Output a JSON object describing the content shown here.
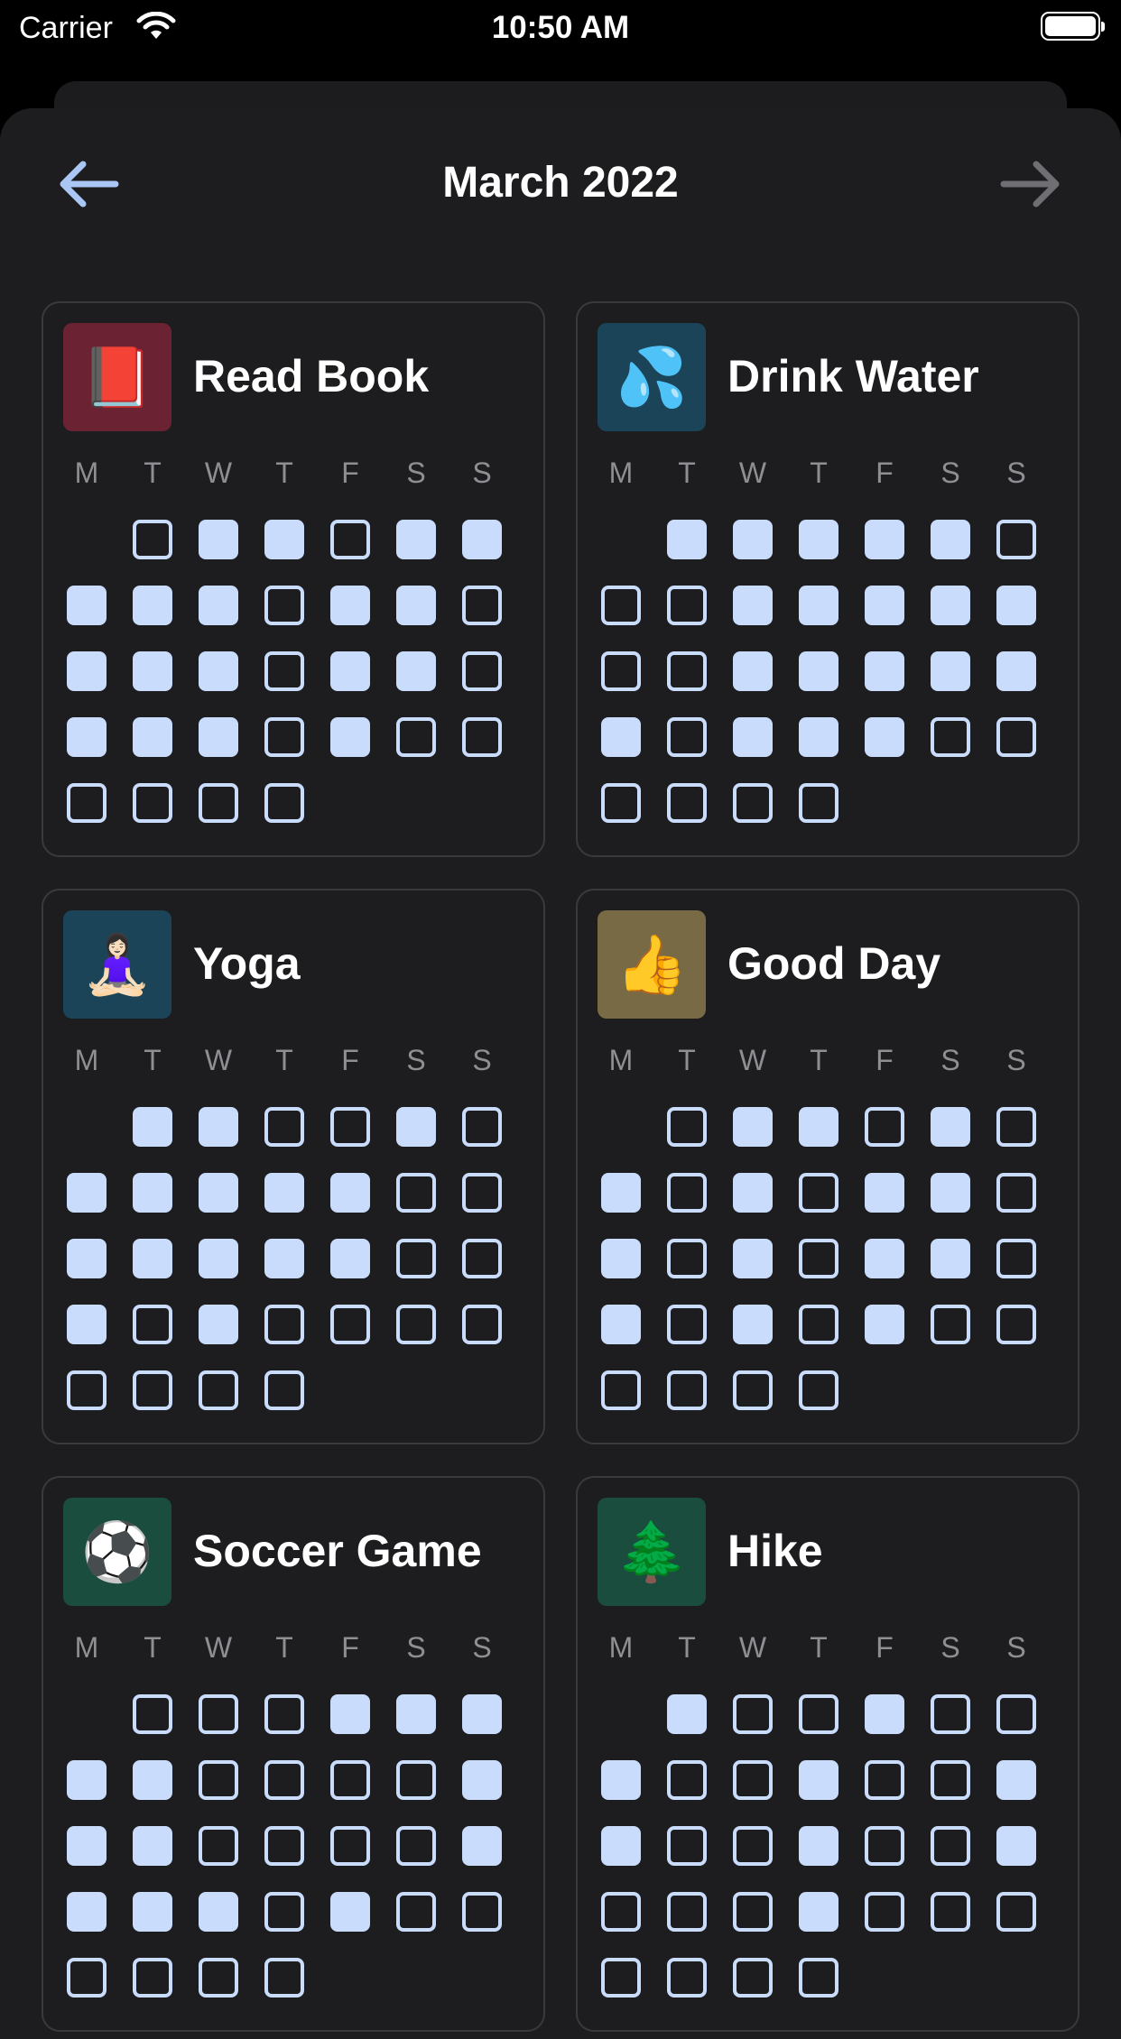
{
  "status_bar": {
    "carrier": "Carrier",
    "time": "10:50 AM"
  },
  "header": {
    "title": "March 2022",
    "back_icon": "arrow-left-icon",
    "next_icon": "arrow-right-icon"
  },
  "colors": {
    "accent": "#c9dcfb",
    "background": "#1d1d20",
    "card_border": "#3a3a3d",
    "weekday": "#8e8e93",
    "next_disabled": "#8e8e93",
    "back_arrow": "#a9c6f5"
  },
  "weekday_labels": [
    "M",
    "T",
    "W",
    "T",
    "F",
    "S",
    "S"
  ],
  "first_weekday_offset": 1,
  "habits": [
    {
      "title": "Read Book",
      "emoji": "📕",
      "icon_color": "#6b2334",
      "days": [
        0,
        1,
        1,
        0,
        1,
        1,
        1,
        1,
        1,
        0,
        1,
        1,
        0,
        1,
        1,
        1,
        0,
        1,
        1,
        0,
        1,
        1,
        1,
        0,
        1,
        0,
        0,
        0,
        0,
        0,
        0
      ]
    },
    {
      "title": "Drink Water",
      "emoji": "💦",
      "icon_color": "#1b4459",
      "days": [
        1,
        1,
        1,
        1,
        1,
        0,
        0,
        0,
        1,
        1,
        1,
        1,
        1,
        0,
        0,
        1,
        1,
        1,
        1,
        1,
        1,
        0,
        1,
        1,
        1,
        0,
        0,
        0,
        0,
        0,
        0
      ]
    },
    {
      "title": "Yoga",
      "emoji": "🧘🏻‍♀️",
      "icon_color": "#1b4459",
      "days": [
        1,
        1,
        0,
        0,
        1,
        0,
        1,
        1,
        1,
        1,
        1,
        0,
        0,
        1,
        1,
        1,
        1,
        1,
        0,
        0,
        1,
        0,
        1,
        0,
        0,
        0,
        0,
        0,
        0,
        0,
        0
      ]
    },
    {
      "title": "Good Day",
      "emoji": "👍",
      "icon_color": "#786a45",
      "days": [
        0,
        1,
        1,
        0,
        1,
        0,
        1,
        0,
        1,
        0,
        1,
        1,
        0,
        1,
        0,
        1,
        0,
        1,
        1,
        0,
        1,
        0,
        1,
        0,
        1,
        0,
        0,
        0,
        0,
        0,
        0
      ]
    },
    {
      "title": "Soccer Game",
      "emoji": "⚽",
      "icon_color": "#1b4d3e",
      "days": [
        0,
        0,
        0,
        1,
        1,
        1,
        1,
        1,
        0,
        0,
        0,
        0,
        1,
        1,
        1,
        0,
        0,
        0,
        0,
        1,
        1,
        1,
        1,
        0,
        1,
        0,
        0,
        0,
        0,
        0,
        0
      ]
    },
    {
      "title": "Hike",
      "emoji": "🌲",
      "icon_color": "#1b4d3e",
      "days": [
        1,
        0,
        0,
        1,
        0,
        0,
        1,
        0,
        0,
        1,
        0,
        0,
        1,
        1,
        0,
        0,
        1,
        0,
        0,
        1,
        0,
        0,
        0,
        1,
        0,
        0,
        0,
        0,
        0,
        0,
        0
      ]
    }
  ]
}
